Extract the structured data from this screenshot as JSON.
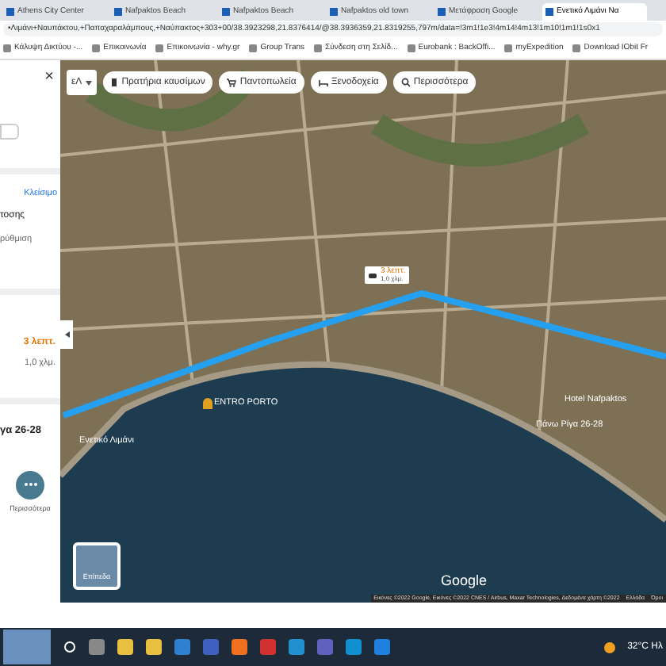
{
  "browser": {
    "tabs": [
      {
        "title": "Athens City Center",
        "selected": false
      },
      {
        "title": "Nafpaktos Beach",
        "selected": false
      },
      {
        "title": "Nafpaktos Beach",
        "selected": false
      },
      {
        "title": "Nafpaktos old town",
        "selected": false
      },
      {
        "title": "Μετάφραση Google",
        "selected": false
      },
      {
        "title": "Ενετικό Λιμάνι Να",
        "selected": true
      }
    ],
    "address": "•Λιμάνι+Ναυπάκτου,+Παπαχαραλάμπους,+Ναύπακτος+303+00/38.3923298,21.8376414/@38.3936359,21.8319255,797m/data=!3m1!1e3!4m14!4m13!1m10!1m1!1s0x1",
    "bookmarks": [
      "Κάλυψη Δικτύου -...",
      "Επικοινωνία",
      "Επικοινωνία - why.gr",
      "Group Trans",
      "Σύνδεση στη Σελίδ...",
      "Eurobank : BackOffi...",
      "myExpedition",
      "Download IObit Fr"
    ]
  },
  "side_panel": {
    "close": "×",
    "link": "Κλείσιμο",
    "line_1": "τοσης",
    "line_2": "ρύθμιση",
    "time": "3 λεπτ.",
    "distance": "1,0 χλμ.",
    "address": "γα 26-28",
    "more": "Περισσότερα"
  },
  "map": {
    "lang": "εΛ",
    "chips": [
      {
        "label": "Πρατήρια καυσίμων"
      },
      {
        "label": "Παντοπωλεία"
      },
      {
        "label": "Ξενοδοχεία"
      },
      {
        "label": "Περισσότερα"
      }
    ],
    "route": {
      "time": "3 λεπτ.",
      "distance": "1,0 χλμ."
    },
    "places": [
      {
        "name": "ENTRO PORTO"
      },
      {
        "name": "Hotel Nafpaktos"
      },
      {
        "name": "Πάνω Ρίγα 26-28"
      },
      {
        "name": "Ενετικό Λιμάνι"
      }
    ],
    "layers": "Επίπεδα",
    "logo": "Google",
    "attribution": "Εικόνες ©2022 Google, Εικόνες ©2022 CNES / Airbus, Maxar Technologies, Δεδομένα χάρτη ©2022",
    "links": [
      "Ελλάδα",
      "Όροι"
    ]
  },
  "taskbar": {
    "weather": "32°C Ηλ"
  }
}
